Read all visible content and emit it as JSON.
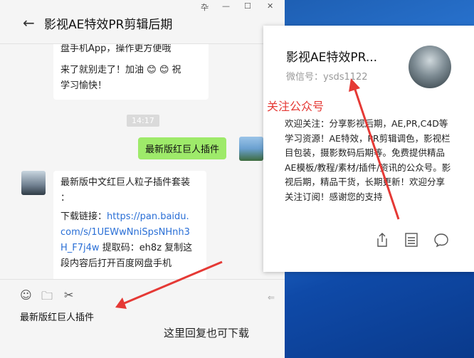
{
  "window": {
    "title": "影视AE特效PR剪辑后期",
    "back_glyph": "←",
    "controls": [
      "卆",
      "—",
      "☐",
      "✕"
    ]
  },
  "messages": {
    "top_bubble_lines": [
      "盘手机App，操作更方便哦",
      "来了就别走了！加油 😊 😊 祝",
      "学习愉快！"
    ],
    "timestamp": "14:17",
    "self_message": "最新版红巨人插件",
    "reply_lines": [
      "最新版中文红巨人粒子插件套装",
      "：",
      "下载链接：",
      "https://pan.baidu.",
      "com/s/1UEWwNniSpsNHnh3",
      "H_F7j4w",
      "提取码：eh8z 复制这",
      "段内容后打开百度网盘手机"
    ]
  },
  "toolbar": {
    "emoji_icon": "☺",
    "folder_icon": "🗀",
    "scissors_icon": "✂",
    "input_text": "最新版红巨人插件",
    "send_hint": "⇐"
  },
  "card": {
    "name": "影视AE特效PR...",
    "id_label": "微信号：ysds1122",
    "description": "欢迎关注：分享影视后期，AE,PR,C4D等学习资源！AE特效，PR剪辑调色，影视栏目包装，摄影数码后期等。免费提供精品AE模板/教程/素材/插件/资讯的公众号。影视后期，精品干货，长期更新！欢迎分享关注订阅！感谢您的支持"
  },
  "annotations": {
    "follow": "关注公众号",
    "reply_hint": "这里回复也可下载"
  },
  "colors": {
    "accent_red": "#e53935",
    "bubble_green": "#9eea6a",
    "link_blue": "#2a6fd6"
  }
}
